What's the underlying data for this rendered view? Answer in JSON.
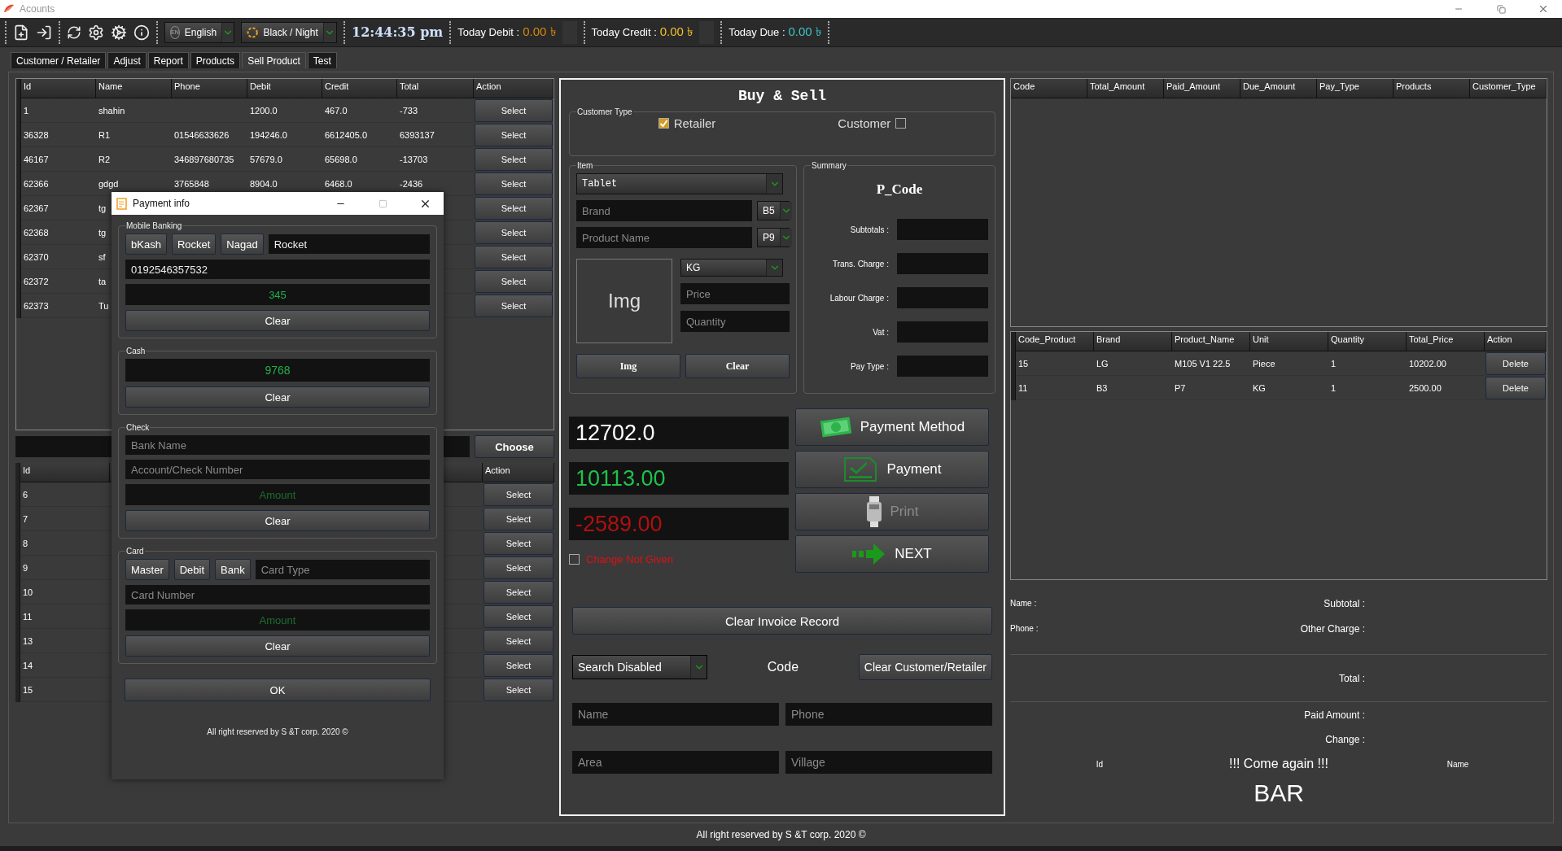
{
  "window": {
    "title": "Acounts"
  },
  "toolbar": {
    "language": {
      "badge": "EN",
      "value": "English"
    },
    "theme": "Black / Night",
    "time": "12:44:35 pm",
    "stats": [
      {
        "label": "Today Debit :",
        "value": "0.00 ৳",
        "color": "#d48a0c"
      },
      {
        "label": "Today Credit :",
        "value": "0.00 ৳",
        "color": "#f2c12e"
      },
      {
        "label": "Today Due :",
        "value": "0.00 ৳",
        "color": "#3fc4c4"
      }
    ]
  },
  "tabs": [
    {
      "label": "Customer / Retailer",
      "selected": false
    },
    {
      "label": "Adjust",
      "selected": false
    },
    {
      "label": "Report",
      "selected": false
    },
    {
      "label": "Products",
      "selected": false
    },
    {
      "label": "Sell Product",
      "selected": true
    },
    {
      "label": "Test",
      "selected": false
    }
  ],
  "accounts_table": {
    "columns": [
      "Id",
      "Name",
      "Phone",
      "Debit",
      "Credit",
      "Total",
      "Action"
    ],
    "rows": [
      {
        "id": "1",
        "name": "shahin",
        "debit": "1200.0",
        "credit": "467.0",
        "total": "-733",
        "action": "Select"
      },
      {
        "id": "36328",
        "name": "R1",
        "phone": "01546633626",
        "debit": "194246.0",
        "credit": "6612405.0",
        "total": "6393137",
        "action": "Select"
      },
      {
        "id": "46167",
        "name": "R2",
        "phone": "346897680735",
        "debit": "57679.0",
        "credit": "65698.0",
        "total": "-13703",
        "action": "Select"
      },
      {
        "id": "62366",
        "name": "gdgd",
        "phone": "3765848",
        "debit": "8904.0",
        "credit": "6468.0",
        "total": "-2436",
        "action": "Select"
      },
      {
        "id": "62367",
        "name": "tg",
        "action": "Select"
      },
      {
        "id": "62368",
        "name": "tg",
        "action": "Select"
      },
      {
        "id": "62370",
        "name": "sf",
        "action": "Select"
      },
      {
        "id": "62372",
        "name": "ta",
        "action": "Select"
      },
      {
        "id": "62373",
        "name": "Tu",
        "action": "Select"
      }
    ]
  },
  "lookup": {
    "button": "Choose"
  },
  "records_table": {
    "columns": [
      "Id",
      "Action"
    ],
    "rows": [
      {
        "id": "6",
        "action": "Select"
      },
      {
        "id": "7",
        "action": "Select"
      },
      {
        "id": "8",
        "action": "Select"
      },
      {
        "id": "9",
        "action": "Select"
      },
      {
        "id": "10",
        "action": "Select"
      },
      {
        "id": "11",
        "action": "Select"
      },
      {
        "id": "13",
        "action": "Select"
      },
      {
        "id": "14",
        "action": "Select"
      },
      {
        "id": "15",
        "action": "Select"
      }
    ]
  },
  "payment_dialog": {
    "title": "Payment info",
    "mobile_banking": {
      "legend": "Mobile Banking",
      "providers": [
        "bKash",
        "Rocket",
        "Nagad"
      ],
      "provider": "Rocket",
      "number": "0192546357532",
      "amount": "345",
      "clear": "Clear"
    },
    "cash": {
      "legend": "Cash",
      "amount": "9768",
      "clear": "Clear"
    },
    "check": {
      "legend": "Check",
      "bank_placeholder": "Bank Name",
      "account_placeholder": "Account/Check Number",
      "amount_placeholder": "Amount",
      "clear": "Clear"
    },
    "card": {
      "legend": "Card",
      "types": [
        "Master",
        "Debit",
        "Bank"
      ],
      "type_placeholder": "Card Type",
      "number_placeholder": "Card Number",
      "amount_placeholder": "Amount",
      "clear": "Clear"
    },
    "ok": "OK",
    "footer": "All right reserved by S &T corp. 2020 ©"
  },
  "sale": {
    "title": "Buy & Sell",
    "customer_type": {
      "legend": "Customer Type",
      "options": [
        {
          "label": "Retailer",
          "checked": true,
          "kind": "leading"
        },
        {
          "label": "Customer",
          "checked": false,
          "kind": "trailing"
        }
      ]
    },
    "item": {
      "legend": "Item",
      "category": "Tablet",
      "brand_placeholder": "Brand",
      "brand_code": "B5",
      "product_placeholder": "Product Name",
      "product_code": "P9",
      "image_label": "Img",
      "unit": "KG",
      "price_placeholder": "Price",
      "quantity_placeholder": "Quantity",
      "buttons": [
        "Img",
        "Clear"
      ]
    },
    "summary": {
      "legend": "Summary",
      "code": "P_Code",
      "fields": [
        "Subtotals :",
        "Trans. Charge :",
        "Labour Charge :",
        "Vat :",
        "Pay Type :"
      ]
    },
    "amounts": [
      {
        "value": "12702.0",
        "color": "#ffffff"
      },
      {
        "value": "10113.00",
        "color": "#1fc24a"
      },
      {
        "value": "-2589.00",
        "color": "#b01010"
      }
    ],
    "change_not_given": {
      "label": "Change Not Given",
      "checked": false
    },
    "actions": [
      {
        "label": "Payment Method",
        "kind": "money",
        "disabled": false
      },
      {
        "label": "Payment",
        "kind": "bill",
        "disabled": false
      },
      {
        "label": "Print",
        "kind": "printer",
        "disabled": true
      },
      {
        "label": "NEXT",
        "kind": "next",
        "disabled": false
      }
    ],
    "clear_invoice": "Clear Invoice Record",
    "search_mode": "Search Disabled",
    "code_label": "Code",
    "clear_customer": "Clear Customer/Retailer",
    "customer_fields": [
      {
        "placeholder": "Name"
      },
      {
        "placeholder": "Phone"
      },
      {
        "placeholder": "Area"
      },
      {
        "placeholder": "Village"
      }
    ]
  },
  "invoices_table": {
    "columns": [
      "Code",
      "Total_Amount",
      "Paid_Amount",
      "Due_Amount",
      "Pay_Type",
      "Products",
      "Customer_Type"
    ]
  },
  "cart_table": {
    "columns": [
      "Code_Product",
      "Brand",
      "Product_Name",
      "Unit",
      "Quantity",
      "Total_Price",
      "Action"
    ],
    "rows": [
      {
        "code": "15",
        "brand": "LG",
        "product": "M105 V1 22.5",
        "unit": "Piece",
        "quantity": "1",
        "total": "10202.00",
        "action": "Delete"
      },
      {
        "code": "11",
        "brand": "B3",
        "product": "P7",
        "unit": "KG",
        "quantity": "1",
        "total": "2500.00",
        "action": "Delete"
      }
    ]
  },
  "receipt": {
    "name_label": "Name :",
    "phone_label": "Phone :",
    "subtotal": "Subtotal :",
    "other_charge": "Other Charge :",
    "total": "Total :",
    "paid": "Paid Amount :",
    "change": "Change :",
    "id_label": "Id",
    "message": "!!! Come again !!!",
    "name_field": "Name",
    "barcode": "BAR"
  },
  "footer": "All right reserved by S &T corp. 2020 ©"
}
